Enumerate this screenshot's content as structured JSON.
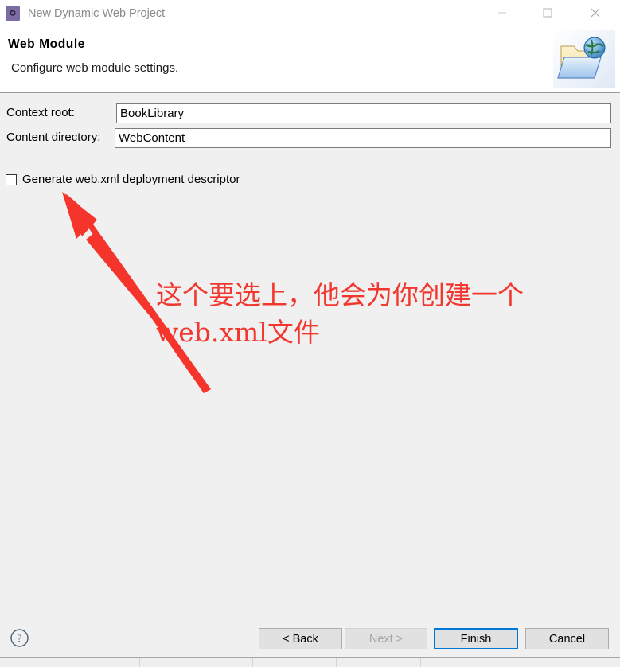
{
  "window": {
    "title": "New Dynamic Web Project",
    "app_icon": "gear-icon",
    "controls": {
      "minimize": "minimize-icon",
      "maximize": "maximize-icon",
      "close": "close-icon"
    }
  },
  "header": {
    "title": "Web Module",
    "subtitle": "Configure web module settings.",
    "banner_icon": "web-folder-globe-icon"
  },
  "form": {
    "context_root": {
      "label": "Context root:",
      "value": "BookLibrary",
      "placeholder": ""
    },
    "content_directory": {
      "label": "Content directory:",
      "value": "WebContent",
      "placeholder": ""
    },
    "generate_webxml": {
      "label": "Generate web.xml deployment descriptor",
      "checked": false
    }
  },
  "annotation": {
    "text": "这个要选上，他会为你创建一个\nweb.xml文件",
    "color": "#f2372f",
    "arrow": "red-arrow-pointing-to-checkbox"
  },
  "footer": {
    "help_icon": "help-question-icon",
    "buttons": {
      "back": "< Back",
      "next": "Next >",
      "finish": "Finish",
      "cancel": "Cancel"
    },
    "focused_button": "Finish",
    "disabled_button": "Next >"
  },
  "colors": {
    "accent": "#0078d7",
    "dialog_bg": "#f0f0f0",
    "header_bg": "#ffffff",
    "annotation_red": "#f2372f",
    "app_icon_purple": "#7d6ba3"
  }
}
